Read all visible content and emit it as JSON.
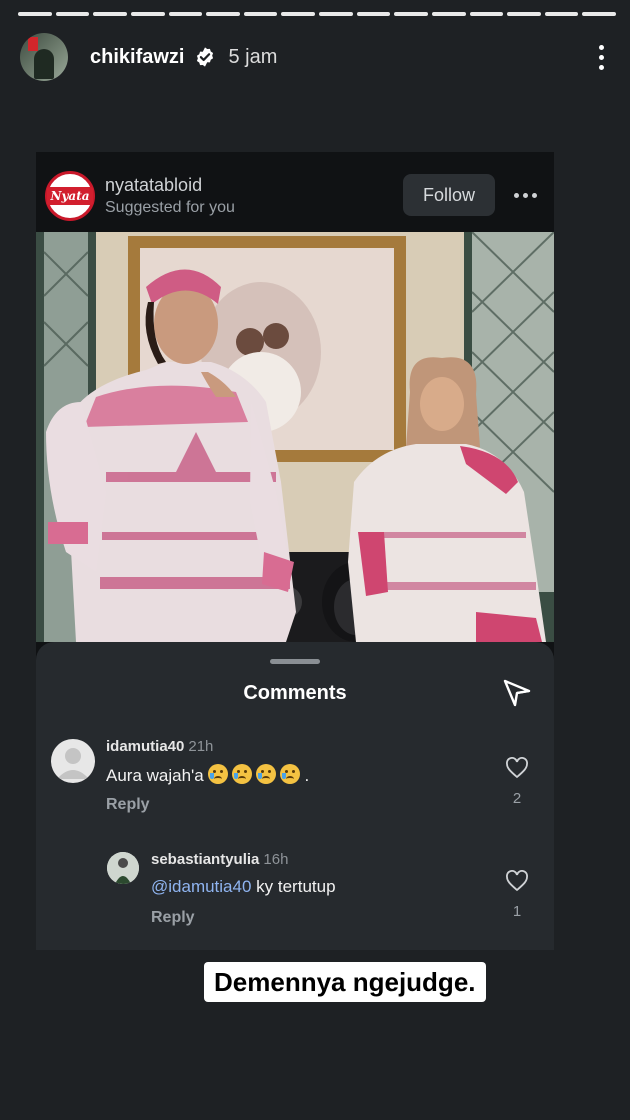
{
  "story": {
    "username": "chikifawzi",
    "time_ago": "5 jam",
    "progress_segments": 16,
    "icons": [
      "verified-badge-icon",
      "more-vertical-icon"
    ]
  },
  "post": {
    "account": "nyatatabloid",
    "logo_text": "Nyata",
    "subtitle": "Suggested for you",
    "follow_label": "Follow"
  },
  "comments_panel": {
    "title": "Comments",
    "comments": [
      {
        "username": "idamutia40",
        "time": "21h",
        "text": "Aura wajah'a",
        "text_after_emojis": ".",
        "emojis": [
          "crying-face-emoji",
          "crying-face-emoji",
          "crying-face-emoji",
          "crying-face-emoji"
        ],
        "reply_label": "Reply",
        "likes": "2"
      },
      {
        "username": "sebastiantyulia",
        "time": "16h",
        "mention": "@idamutia40",
        "text": " ky tertutup",
        "reply_label": "Reply",
        "likes": "1"
      }
    ]
  },
  "caption": "Demennya ngejudge.",
  "colors": {
    "background": "#1e2124",
    "panel": "#262a2e",
    "mention": "#8fb4f0",
    "brand_red": "#d21f2e"
  }
}
